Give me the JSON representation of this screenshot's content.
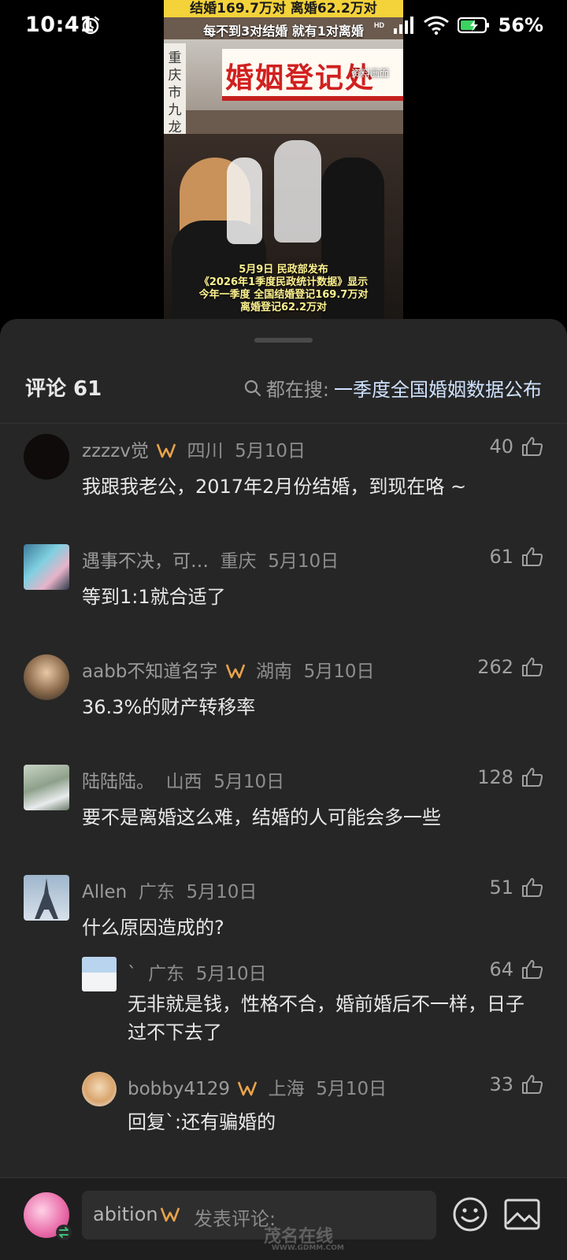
{
  "status_bar": {
    "time": "10:41",
    "battery_percent": "56%",
    "icons": [
      "alarm-icon",
      "hd-icon",
      "signal-icon",
      "wifi-icon",
      "battery-icon"
    ]
  },
  "video": {
    "top_banner": "结婚169.7万对  离婚62.2万对",
    "sub_banner": "每不到3对结婚  就有1对离婚",
    "sign_text": "婚姻登记处",
    "caption_tag": "资料画面",
    "side_sign": "重庆市九龙坡区婚姻登记",
    "bottom_text_lines": [
      "5月9日 民政部发布",
      "《2026年1季度民政统计数据》显示",
      "今年一季度 全国结婚登记169.7万对",
      "离婚登记62.2万对"
    ]
  },
  "sheet": {
    "title": "评论 61",
    "search_prefix": "都在搜:",
    "search_keyword": "一季度全国婚姻数据公布"
  },
  "comments": [
    {
      "user": "zzzzv觉",
      "has_badge": true,
      "region": "四川",
      "date": "5月10日",
      "likes": "40",
      "text": "我跟我老公，2017年2月份结婚，到现在咯 ~"
    },
    {
      "user": "遇事不决，可…",
      "has_badge": false,
      "region": "重庆",
      "date": "5月10日",
      "likes": "61",
      "text": "等到1:1就合适了"
    },
    {
      "user": "aabb不知道名字",
      "has_badge": true,
      "region": "湖南",
      "date": "5月10日",
      "likes": "262",
      "text": "36.3%的财产转移率"
    },
    {
      "user": "陆陆陆。",
      "has_badge": false,
      "region": "山西",
      "date": "5月10日",
      "likes": "128",
      "text": "要不是离婚这么难，结婚的人可能会多一些"
    },
    {
      "user": "Allen",
      "has_badge": false,
      "region": "广东",
      "date": "5月10日",
      "likes": "51",
      "text": "什么原因造成的?"
    }
  ],
  "replies": [
    {
      "user": "`",
      "has_badge": false,
      "region": "广东",
      "date": "5月10日",
      "likes": "64",
      "text": "无非就是钱，性格不合，婚前婚后不一样，日子过不下去了"
    },
    {
      "user": "bobby4129",
      "has_badge": true,
      "region": "上海",
      "date": "5月10日",
      "likes": "33",
      "text": "回复`:还有骗婚的"
    }
  ],
  "bottom_bar": {
    "username": "abition",
    "placeholder": "发表评论:",
    "watermark": "茂名在线",
    "watermark_url": "WWW.GDMM.COM"
  },
  "colors": {
    "sheet_bg": "#262626",
    "badge": "#e8a34a",
    "search_keyword": "#cfe2ff",
    "banner_yellow": "#f4d23a"
  }
}
